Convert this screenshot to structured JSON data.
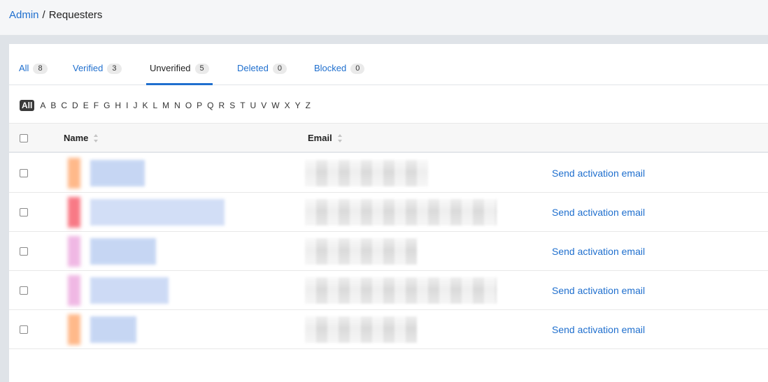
{
  "breadcrumb": {
    "parent": "Admin",
    "separator": "/",
    "current": "Requesters"
  },
  "tabs": [
    {
      "label": "All",
      "count": "8"
    },
    {
      "label": "Verified",
      "count": "3"
    },
    {
      "label": "Unverified",
      "count": "5",
      "active": true
    },
    {
      "label": "Deleted",
      "count": "0"
    },
    {
      "label": "Blocked",
      "count": "0"
    }
  ],
  "alphabet": [
    "All",
    "A",
    "B",
    "C",
    "D",
    "E",
    "F",
    "G",
    "H",
    "I",
    "J",
    "K",
    "L",
    "M",
    "N",
    "O",
    "P",
    "Q",
    "R",
    "S",
    "T",
    "U",
    "V",
    "W",
    "X",
    "Y",
    "Z"
  ],
  "table": {
    "columns": {
      "name": "Name",
      "email": "Email"
    },
    "rows": [
      {
        "action": "Send activation email",
        "avatar_color": "#ffb98a",
        "name_color": "#b9cdf1"
      },
      {
        "action": "Send activation email",
        "avatar_color": "#f87a86",
        "name_color": "#c7d6f4"
      },
      {
        "action": "Send activation email",
        "avatar_color": "#f0b8e4",
        "name_color": "#b9cdf1"
      },
      {
        "action": "Send activation email",
        "avatar_color": "#f0b8e4",
        "name_color": "#c1d2f3"
      },
      {
        "action": "Send activation email",
        "avatar_color": "#ffb98a",
        "name_color": "#b9cdf1"
      }
    ]
  },
  "colors": {
    "accent": "#1f6fce",
    "header_bg": "#f5f6f8",
    "page_bg": "#dfe3e8"
  }
}
